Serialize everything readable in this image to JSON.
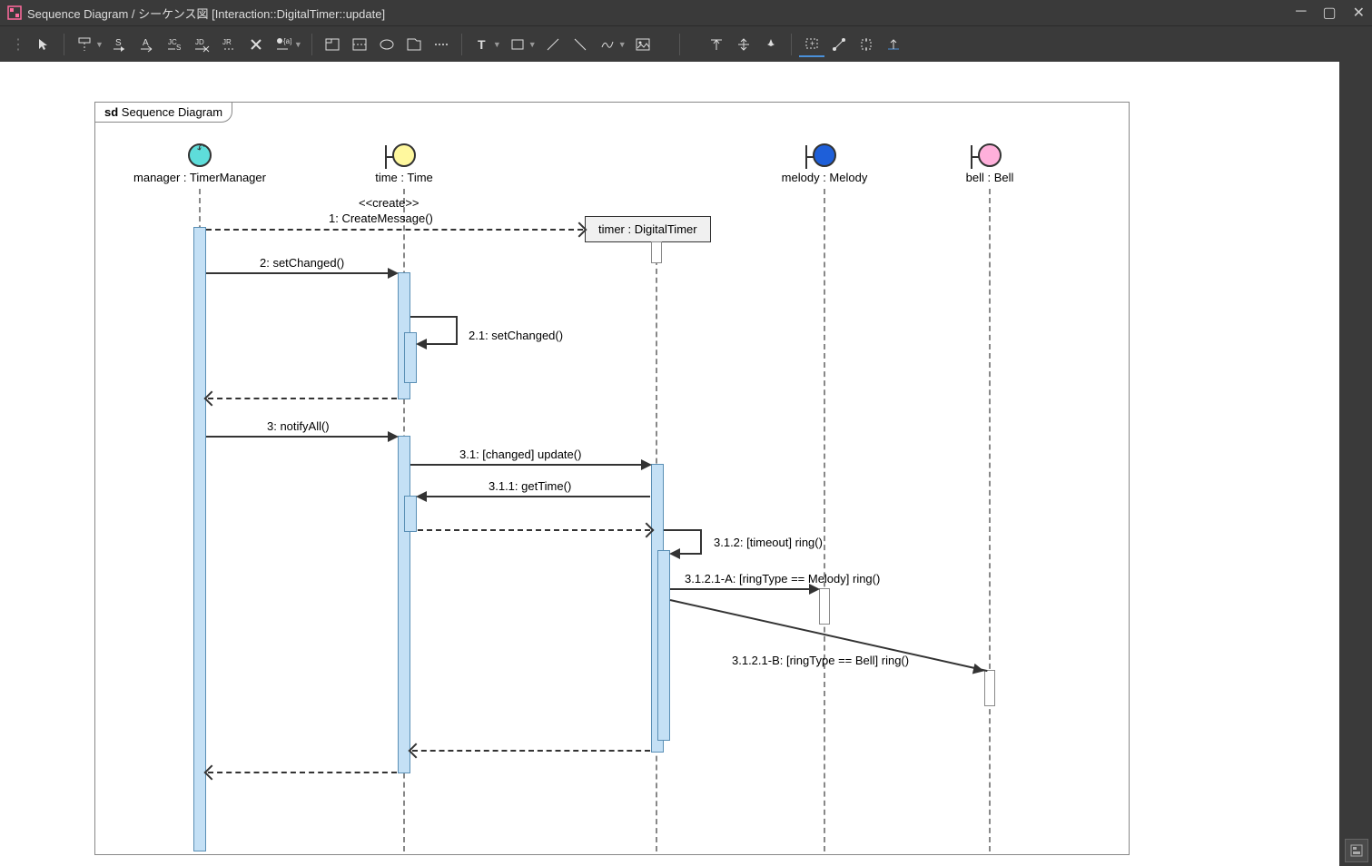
{
  "window": {
    "title": "Sequence Diagram / シーケンス図 [Interaction::DigitalTimer::update]"
  },
  "frame": {
    "prefix": "sd",
    "name": "Sequence Diagram"
  },
  "lifelines": {
    "manager": {
      "label": "manager : TimerManager",
      "color": "cyan",
      "type": "control"
    },
    "time": {
      "label": "time : Time",
      "color": "yellow",
      "type": "boundary"
    },
    "timer": {
      "label": "timer : DigitalTimer",
      "type": "box"
    },
    "melody": {
      "label": "melody : Melody",
      "color": "blue",
      "type": "boundary"
    },
    "bell": {
      "label": "bell : Bell",
      "color": "pink",
      "type": "boundary"
    }
  },
  "messages": {
    "create_stereo": "<<create>>",
    "m1": "1: CreateMessage()",
    "m2": "2: setChanged()",
    "m2_1": "2.1: setChanged()",
    "m3": "3: notifyAll()",
    "m3_1": "3.1: [changed] update()",
    "m3_1_1": "3.1.1: getTime()",
    "m3_1_2": "3.1.2: [timeout] ring()",
    "m3_1_2_1a": "3.1.2.1-A: [ringType == Melody] ring()",
    "m3_1_2_1b": "3.1.2.1-B: [ringType == Bell] ring()"
  },
  "toolbar": {
    "groups": [
      [
        "pointer"
      ],
      [
        "lifeline",
        "lifeline-s",
        "lifeline-a",
        "lifeline-sq",
        "lifeline-dr",
        "lifeline-ri",
        "destroy",
        "message"
      ],
      [
        "frame",
        "alt",
        "oval",
        "tab",
        "note"
      ],
      [
        "text",
        "rect",
        "line",
        "line2",
        "curve"
      ],
      [
        "image"
      ],
      [
        "align-top",
        "align-mid",
        "pin"
      ],
      [
        "fit",
        "zoom",
        "crop",
        "overview"
      ]
    ]
  }
}
